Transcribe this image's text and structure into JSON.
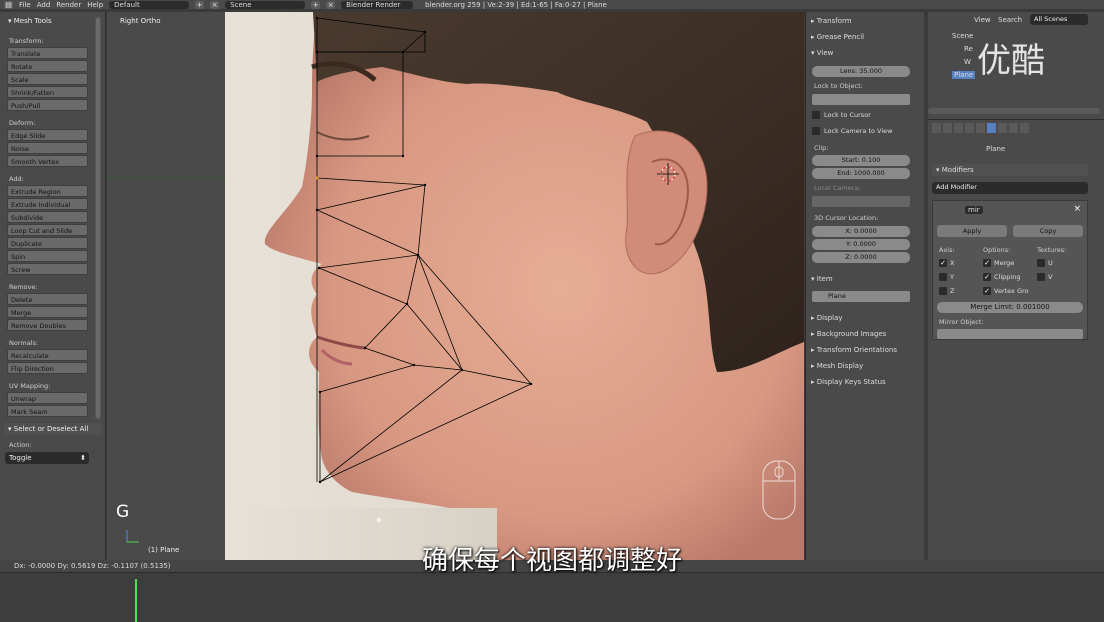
{
  "topbar": {
    "menus": [
      "File",
      "Add",
      "Render",
      "Help"
    ],
    "layout": "Default",
    "scene": "Scene",
    "engine": "Blender Render",
    "stats": "blender.org 259 | Ve:2-39 | Ed:1-65 | Fa:0-27 | Plane"
  },
  "tools": {
    "title": "Mesh Tools",
    "sections": [
      {
        "label": "Transform:",
        "buttons": [
          "Translate",
          "Rotate",
          "Scale",
          "Shrink/Fatten",
          "Push/Pull"
        ]
      },
      {
        "label": "Deform:",
        "buttons": [
          "Edge Slide",
          "Noise",
          "Smooth Vertex"
        ]
      },
      {
        "label": "Add:",
        "buttons": [
          "Extrude Region",
          "Extrude Individual",
          "Subdivide",
          "Loop Cut and Slide",
          "Duplicate",
          "Spin",
          "Screw"
        ]
      },
      {
        "label": "Remove:",
        "buttons": [
          "Delete",
          "Merge",
          "Remove Doubles"
        ]
      },
      {
        "label": "Normals:",
        "buttons": [
          "Recalculate",
          "Flip Direction"
        ]
      },
      {
        "label": "UV Mapping:",
        "buttons": [
          "Unwrap",
          "Mark Seam"
        ]
      }
    ],
    "operator_title": "Select or Deselect All",
    "action_label": "Action:",
    "action_value": "Toggle"
  },
  "viewport": {
    "view_label": "Right Ortho",
    "key_hint": "G",
    "object_label": "(1) Plane"
  },
  "npanel": {
    "transform": "Transform",
    "grease_pencil": "Grease Pencil",
    "view": "View",
    "lens": "Lens: 35.000",
    "lock_to_object": "Lock to Object:",
    "lock_to_cursor": "Lock to Cursor",
    "lock_camera": "Lock Camera to View",
    "clip": "Clip:",
    "clip_start": "Start: 0.100",
    "clip_end": "End: 1000.000",
    "local_camera": "Local Camera:",
    "cursor_location": "3D Cursor Location:",
    "cursor_x": "X: 0.0000",
    "cursor_y": "Y: 0.0000",
    "cursor_z": "Z: 0.0000",
    "item": "Item",
    "item_name": "Plane",
    "display": "Display",
    "background_images": "Background Images",
    "transform_orientations": "Transform Orientations",
    "mesh_display": "Mesh Display",
    "display_keys": "Display Keys Status"
  },
  "outliner": {
    "view": "View",
    "search": "Search",
    "scenes": "All Scenes",
    "items": [
      "Scene",
      "Re",
      "W",
      "Plane"
    ]
  },
  "props": {
    "object_name": "Plane",
    "modifiers_header": "Modifiers",
    "add_modifier": "Add Modifier",
    "modifier_name": "mir",
    "apply": "Apply",
    "copy": "Copy",
    "axis_label": "Axis:",
    "options_label": "Options:",
    "textures_label": "Textures:",
    "axis": [
      "X",
      "Y",
      "Z"
    ],
    "options": [
      "Merge",
      "Clipping",
      "Vertex Gro"
    ],
    "textures": [
      "U",
      "V"
    ],
    "merge_limit": "Merge Limit: 0.001000",
    "mirror_object": "Mirror Object:"
  },
  "status": {
    "delta": "Dx: -0.0000   Dy: 0.5619   Dz: -0.1107 (0.5135)"
  },
  "subtitle": "确保每个视图都调整好",
  "watermark": "优酷",
  "colors": {
    "accent_blue": "#5680c2",
    "timeline_cursor": "#50e050",
    "mesh_wire": "#000000"
  }
}
